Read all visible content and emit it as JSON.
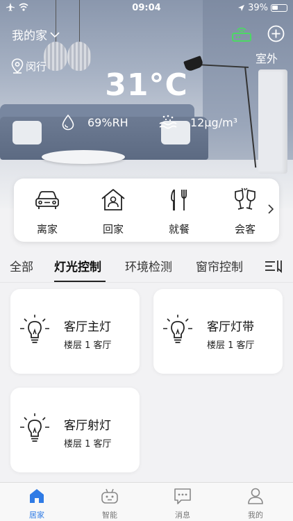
{
  "status_bar": {
    "time": "09:04",
    "battery": "39%"
  },
  "header": {
    "home_name": "我的家",
    "location": "闵行",
    "outdoor_label": "室外",
    "temperature": "31°C",
    "humidity": "69%RH",
    "pm25": "12μg/m³"
  },
  "scenes": [
    {
      "label": "离家",
      "icon": "car-icon"
    },
    {
      "label": "回家",
      "icon": "house-icon"
    },
    {
      "label": "就餐",
      "icon": "fork-knife-icon"
    },
    {
      "label": "会客",
      "icon": "wine-glasses-icon"
    }
  ],
  "tabs": [
    {
      "label": "全部"
    },
    {
      "label": "灯光控制",
      "active": true
    },
    {
      "label": "环境检测"
    },
    {
      "label": "窗帘控制"
    }
  ],
  "devices": [
    {
      "name": "客厅主灯",
      "location": "楼层 1 客厅",
      "icon": "bulb-icon"
    },
    {
      "name": "客厅灯带",
      "location": "楼层 1 客厅",
      "icon": "bulb-icon"
    },
    {
      "name": "客厅射灯",
      "location": "楼层 1 客厅",
      "icon": "bulb-icon"
    }
  ],
  "nav": [
    {
      "label": "居家",
      "icon": "home-icon",
      "active": true
    },
    {
      "label": "智能",
      "icon": "robot-icon"
    },
    {
      "label": "消息",
      "icon": "message-icon"
    },
    {
      "label": "我的",
      "icon": "person-icon"
    }
  ],
  "colors": {
    "accent": "#2f7be5",
    "router": "#4cd964"
  }
}
